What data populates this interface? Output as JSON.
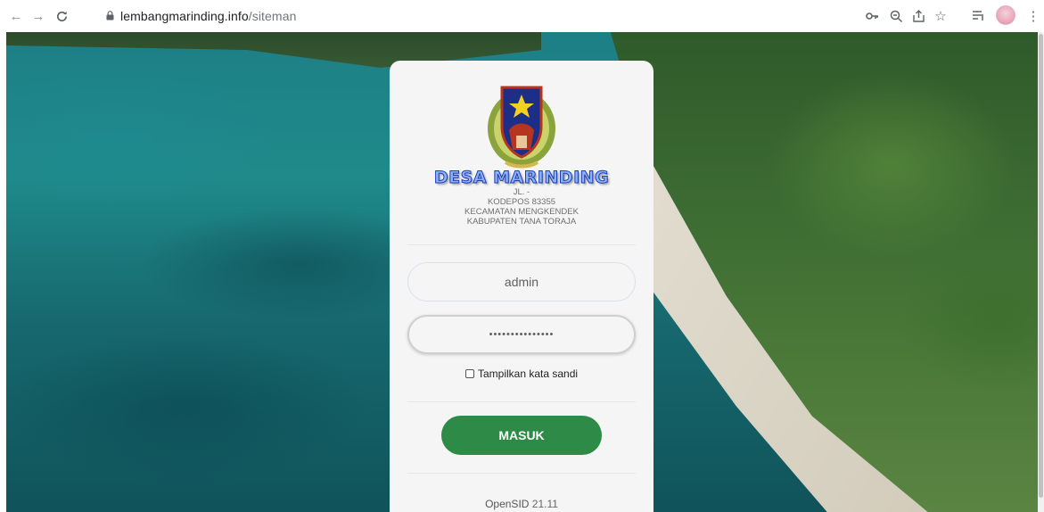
{
  "browser": {
    "url_host": "lembangmarinding.info",
    "url_path": "/siteman",
    "icons": [
      "back-arrow-icon",
      "forward-arrow-icon",
      "reload-icon",
      "lock-icon",
      "key-icon",
      "zoom-icon",
      "share-icon",
      "star-icon",
      "reading-list-icon",
      "profile-avatar",
      "menu-dots-icon"
    ]
  },
  "login": {
    "village_name": "DESA MARINDING",
    "address_lines": [
      "JL. -",
      "KODEPOS 83355",
      "KECAMATAN MENGKENDEK",
      "KABUPATEN TANA TORAJA"
    ],
    "username_value": "admin",
    "password_masked": "•••••••••••••••",
    "show_password_label": "Tampilkan kata sandi",
    "submit_label": "MASUK",
    "version_prefix": "OpenSID",
    "version_number": "21.11"
  },
  "colors": {
    "button": "#2e8a47",
    "title_fill": "#8fb0ff",
    "title_outline": "#1a3fb0"
  }
}
